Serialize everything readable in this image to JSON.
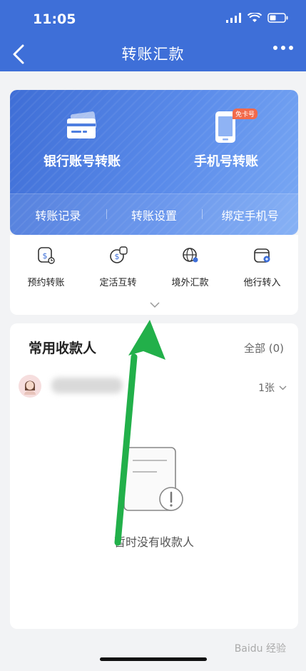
{
  "status_bar": {
    "time": "11:05"
  },
  "nav": {
    "title": "转账汇款"
  },
  "card": {
    "items": [
      {
        "label": "银行账号转账"
      },
      {
        "label": "手机号转账",
        "badge": "免卡号"
      }
    ],
    "links": [
      {
        "label": "转账记录"
      },
      {
        "label": "转账设置"
      },
      {
        "label": "绑定手机号"
      }
    ]
  },
  "quick_actions": [
    {
      "label": "预约转账",
      "icon": "clock-yuan-icon"
    },
    {
      "label": "定活互转",
      "icon": "exchange-yuan-icon"
    },
    {
      "label": "境外汇款",
      "icon": "globe-icon"
    },
    {
      "label": "他行转入",
      "icon": "wallet-in-icon"
    }
  ],
  "payees": {
    "title": "常用收款人",
    "all_label": "全部 (0)",
    "row": {
      "cards": "1张"
    },
    "empty_text": "暂时没有收款人"
  },
  "watermark": "Baidu 经验",
  "colors": {
    "brand": "#3e6fd8",
    "arrow": "#22b04a"
  }
}
